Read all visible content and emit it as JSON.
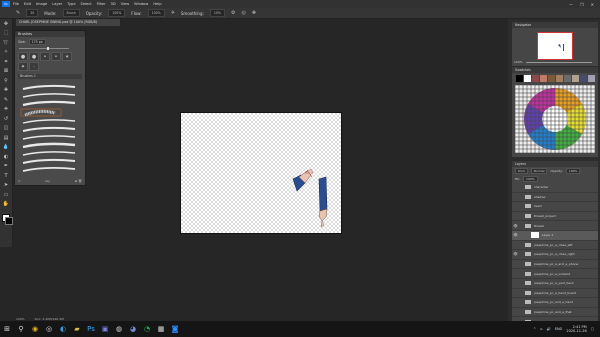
{
  "menu": {
    "app_badge": "Ps",
    "items": [
      "File",
      "Edit",
      "Image",
      "Layer",
      "Type",
      "Select",
      "Filter",
      "3D",
      "View",
      "Window",
      "Help"
    ],
    "window_controls": [
      "—",
      "❐",
      "✕"
    ]
  },
  "options": {
    "size": "30",
    "mode_label": "Mode:",
    "mode_value": "Brush",
    "opacity_label": "Opacity:",
    "opacity_value": "100%",
    "flow_label": "Flow:",
    "flow_value": "100%",
    "smoothing_label": "Smoothing:",
    "smoothing_value": "10%"
  },
  "document": {
    "tab_title": "CHARL JOSEPHINE SWING.psd @ 100% (RGB/8)",
    "zoom": "100%",
    "doc_size": "Doc: 4.40M/190.4M"
  },
  "brushes": {
    "title": "Brushes",
    "size_label": "Size:",
    "size_value": "175 px",
    "folder_name": "Brushes 1",
    "footer_left": "⊙",
    "footer_mid": "Gly",
    "footer_right": "⊞ 🗑"
  },
  "navigator": {
    "title": "Navigator",
    "zoom": "100%"
  },
  "swatches": {
    "title": "Swatches",
    "colors": [
      "#000000",
      "#ffffff",
      "#8b4a4a",
      "#c07a6a",
      "#7a5a3a",
      "#a08060",
      "#6a6a6a",
      "#b0a090",
      "#4a4a6a",
      "#a0a0b0"
    ]
  },
  "layers": {
    "title": "Layers",
    "kind_label": "Kind",
    "blend": "Normal",
    "opacity_label": "Opacity:",
    "opacity_value": "100%",
    "fill_label": "Fill:",
    "fill_value": "100%",
    "items": [
      {
        "name": "character",
        "type": "folder",
        "visible": false,
        "selected": false
      },
      {
        "name": "shadow",
        "type": "folder",
        "visible": false,
        "selected": false
      },
      {
        "name": "head",
        "type": "folder",
        "visible": false,
        "selected": false
      },
      {
        "name": "thread_project",
        "type": "folder",
        "visible": false,
        "selected": false
      },
      {
        "name": "thread",
        "type": "folder",
        "visible": true,
        "selected": false
      },
      {
        "name": "Layer 1",
        "type": "layer",
        "visible": true,
        "selected": true
      },
      {
        "name": "josephine_pc_a_close_left",
        "type": "folder",
        "visible": false,
        "selected": false
      },
      {
        "name": "josephine_pc_a_close_right",
        "type": "folder",
        "visible": true,
        "selected": false
      },
      {
        "name": "josephine_pc_a_and_a_phone",
        "type": "folder",
        "visible": false,
        "selected": false
      },
      {
        "name": "josephine_pc_a_undecid",
        "type": "folder",
        "visible": false,
        "selected": false
      },
      {
        "name": "josephine_pc_a_yard_back",
        "type": "folder",
        "visible": false,
        "selected": false
      },
      {
        "name": "josephine_pc_a_hand_board",
        "type": "folder",
        "visible": false,
        "selected": false
      },
      {
        "name": "josephine_pc_and_a_hand",
        "type": "folder",
        "visible": false,
        "selected": false
      },
      {
        "name": "josephine_pc_and_a_that",
        "type": "folder",
        "visible": false,
        "selected": false
      },
      {
        "name": "josephine_pc_and_a_flat3",
        "type": "folder",
        "visible": false,
        "selected": false
      },
      {
        "name": "josephine_pc_and_a_fingery",
        "type": "folder",
        "visible": false,
        "selected": false
      },
      {
        "name": "josephine_pc_a_compose",
        "type": "folder",
        "visible": false,
        "selected": false
      }
    ],
    "footer": "⛓ fx ◐ ◑ 📁 ⊞ 🗑"
  },
  "taskbar": {
    "icons": [
      "windows-icon",
      "search-icon",
      "chrome-icon",
      "obs-icon",
      "edge-icon",
      "folder-icon",
      "photoshop-icon",
      "teams-icon",
      "steam-icon",
      "discord-icon",
      "spotify-icon",
      "explorer-icon",
      "zoom-icon"
    ],
    "tray_lang": "ENG",
    "time": "2:41 PM",
    "date": "2020-11-26"
  },
  "colors": {
    "accent": "#1473e6",
    "bg": "#262626",
    "panel": "#464646"
  }
}
